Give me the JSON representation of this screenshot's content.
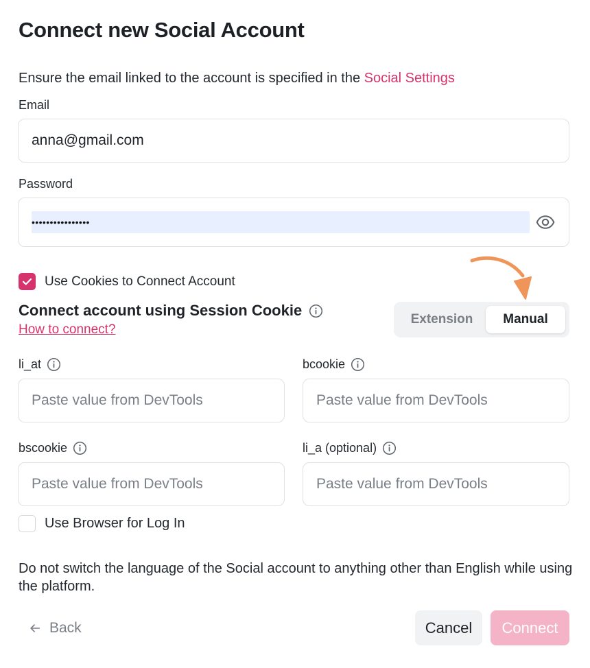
{
  "dialog": {
    "title": "Connect new Social Account",
    "notice_prefix": "Ensure the email linked to the account is specified in the ",
    "notice_link": "Social Settings"
  },
  "email": {
    "label": "Email",
    "value": "anna@gmail.com"
  },
  "password": {
    "label": "Password",
    "masked_value": "••••••••••••••••",
    "toggle_icon": "eye-icon"
  },
  "cookies_checkbox": {
    "label": "Use Cookies to Connect Account",
    "checked": true
  },
  "session": {
    "title": "Connect account using Session Cookie",
    "help_link": "How to connect?",
    "mode_options": [
      "Extension",
      "Manual"
    ],
    "selected_mode": "Manual"
  },
  "cookie_fields": [
    {
      "label": "li_at",
      "placeholder": "Paste value from DevTools"
    },
    {
      "label": "bcookie",
      "placeholder": "Paste value from DevTools"
    },
    {
      "label": "bscookie",
      "placeholder": "Paste value from DevTools"
    },
    {
      "label": "li_a (optional)",
      "placeholder": "Paste value from DevTools"
    }
  ],
  "browser_checkbox": {
    "label": "Use Browser for Log In",
    "checked": false
  },
  "footnote": "Do not switch the language of the Social account to anything other than English while using the platform.",
  "footer": {
    "back_label": "Back",
    "cancel_label": "Cancel",
    "connect_label": "Connect"
  },
  "colors": {
    "accent": "#d6336c",
    "accent_disabled": "#f5b3c8",
    "annotation_arrow": "#f0955a"
  }
}
